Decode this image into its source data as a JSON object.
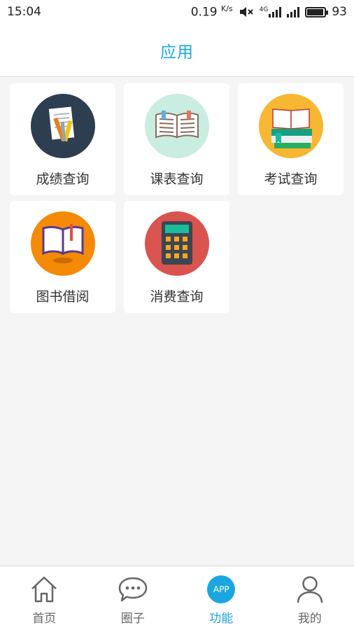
{
  "status_bar": {
    "time": "15:04",
    "speed": "0.19",
    "speed_unit": "K/s",
    "network": "4G",
    "battery": "93"
  },
  "header": {
    "title": "应用"
  },
  "apps": [
    {
      "label": "成绩查询",
      "icon": "grade-report-icon",
      "color": "#2c3e50"
    },
    {
      "label": "课表查询",
      "icon": "open-book-icon",
      "color": "#c9ede0"
    },
    {
      "label": "考试查询",
      "icon": "stacked-books-icon",
      "color": "#f7b733"
    },
    {
      "label": "图书借阅",
      "icon": "library-book-icon",
      "color": "#f58a07"
    },
    {
      "label": "消费查询",
      "icon": "calculator-icon",
      "color": "#d9534f"
    }
  ],
  "tab_bar": {
    "tabs": [
      {
        "label": "首页",
        "icon": "home-icon"
      },
      {
        "label": "圈子",
        "icon": "chat-bubble-icon"
      },
      {
        "label": "功能",
        "icon": "app-icon",
        "badge": "APP",
        "active": true
      },
      {
        "label": "我的",
        "icon": "user-icon"
      }
    ],
    "accent": "#1ba6e0"
  }
}
